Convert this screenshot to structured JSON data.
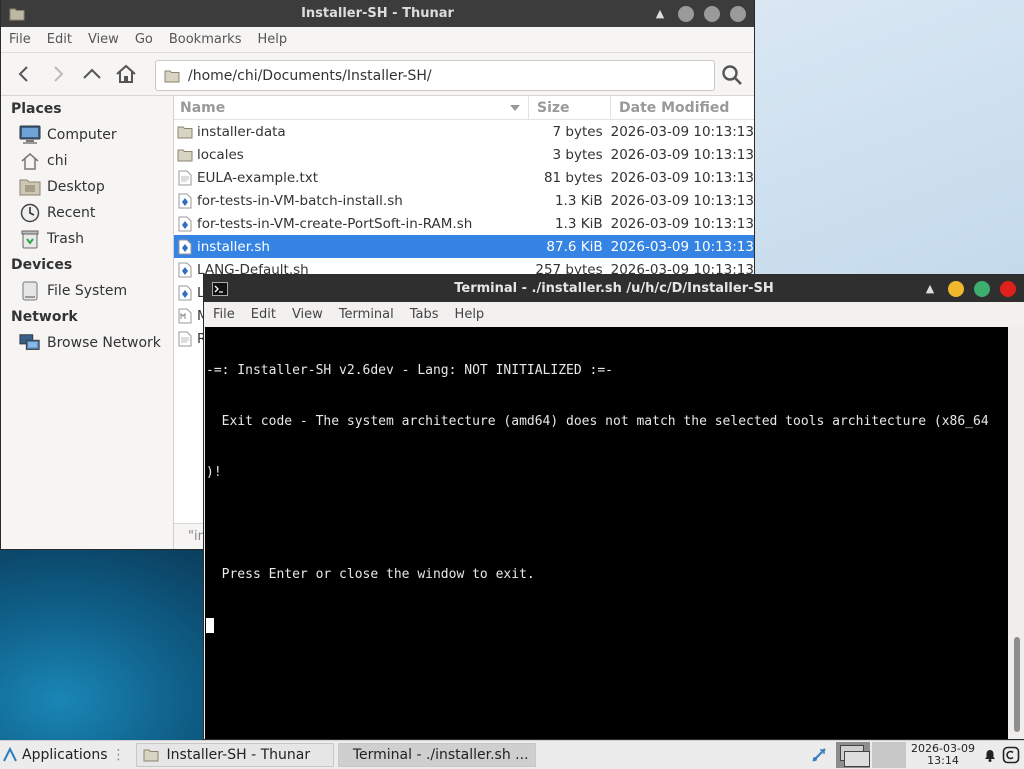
{
  "thunar": {
    "title": "Installer-SH - Thunar",
    "menu": [
      "File",
      "Edit",
      "View",
      "Go",
      "Bookmarks",
      "Help"
    ],
    "path": "/home/chi/Documents/Installer-SH/",
    "sidebar": {
      "places_header": "Places",
      "places": [
        {
          "label": "Computer",
          "icon": "computer-icon"
        },
        {
          "label": "chi",
          "icon": "home-icon"
        },
        {
          "label": "Desktop",
          "icon": "desktop-icon"
        },
        {
          "label": "Recent",
          "icon": "recent-icon"
        },
        {
          "label": "Trash",
          "icon": "trash-icon"
        }
      ],
      "devices_header": "Devices",
      "devices": [
        {
          "label": "File System",
          "icon": "drive-icon"
        }
      ],
      "network_header": "Network",
      "network": [
        {
          "label": "Browse Network",
          "icon": "network-icon"
        }
      ]
    },
    "columns": {
      "name": "Name",
      "size": "Size",
      "date": "Date Modified"
    },
    "files": [
      {
        "name": "installer-data",
        "size": "7 bytes",
        "date": "2026-03-09 10:13:13",
        "type": "folder"
      },
      {
        "name": "locales",
        "size": "3 bytes",
        "date": "2026-03-09 10:13:13",
        "type": "folder"
      },
      {
        "name": "EULA-example.txt",
        "size": "81 bytes",
        "date": "2026-03-09 10:13:13",
        "type": "text"
      },
      {
        "name": "for-tests-in-VM-batch-install.sh",
        "size": "1.3 KiB",
        "date": "2026-03-09 10:13:13",
        "type": "script"
      },
      {
        "name": "for-tests-in-VM-create-PortSoft-in-RAM.sh",
        "size": "1.3 KiB",
        "date": "2026-03-09 10:13:13",
        "type": "script"
      },
      {
        "name": "installer.sh",
        "size": "87.6 KiB",
        "date": "2026-03-09 10:13:13",
        "type": "script",
        "selected": true
      },
      {
        "name": "LANG-Default.sh",
        "size": "257 bytes",
        "date": "2026-03-09 10:13:13",
        "type": "script"
      },
      {
        "name": "L",
        "size": "",
        "date": "",
        "type": "script"
      },
      {
        "name": "M",
        "size": "",
        "date": "",
        "type": "markdown"
      },
      {
        "name": "R",
        "size": "",
        "date": "",
        "type": "text"
      }
    ],
    "status": "\"in"
  },
  "terminal": {
    "title": "Terminal - ./installer.sh  /u/h/c/D/Installer-SH",
    "menu": [
      "File",
      "Edit",
      "View",
      "Terminal",
      "Tabs",
      "Help"
    ],
    "lines": [
      "-=: Installer-SH v2.6dev - Lang: NOT INITIALIZED :=-",
      "  Exit code - The system architecture (amd64) does not match the selected tools architecture (x86_64",
      ")!",
      "",
      "  Press Enter or close the window to exit."
    ]
  },
  "taskbar": {
    "applications": "Applications",
    "windows": [
      {
        "label": "Installer-SH - Thunar",
        "icon": "folder-icon",
        "active": false
      },
      {
        "label": "Terminal - ./installer.sh  ...",
        "icon": "terminal-icon",
        "active": true
      }
    ],
    "clock_date": "2026-03-09",
    "clock_time": "13:14"
  },
  "colors": {
    "selection": "#3584e4",
    "close_red": "#e0201b",
    "min_yellow": "#f0b82d",
    "max_green": "#3dae6d"
  }
}
